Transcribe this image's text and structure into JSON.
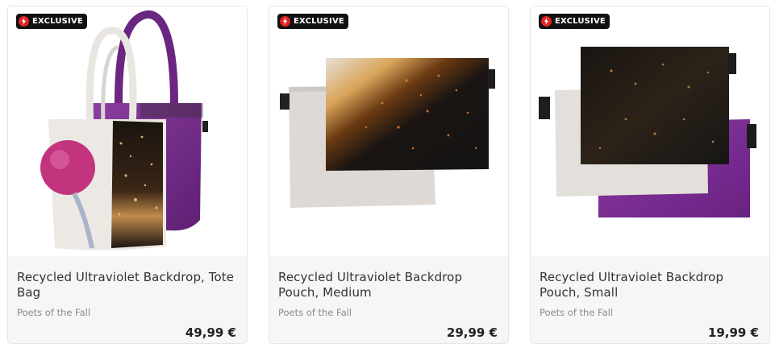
{
  "products": [
    {
      "badge": "EXCLUSIVE",
      "title": "Recycled Ultraviolet Backdrop, Tote Bag",
      "brand": "Poets of the Fall",
      "price": "49,99 €",
      "image": "tote-bag"
    },
    {
      "badge": "EXCLUSIVE",
      "title": "Recycled Ultraviolet Backdrop Pouch, Medium",
      "brand": "Poets of the Fall",
      "price": "29,99 €",
      "image": "pouch-medium"
    },
    {
      "badge": "EXCLUSIVE",
      "title": "Recycled Ultraviolet Backdrop Pouch, Small",
      "brand": "Poets of the Fall",
      "price": "19,99 €",
      "image": "pouch-small"
    }
  ],
  "colors": {
    "badge_bg": "#111111",
    "badge_icon": "#e02424",
    "purple": "#7b2a8a",
    "info_bg": "#f6f6f6"
  }
}
